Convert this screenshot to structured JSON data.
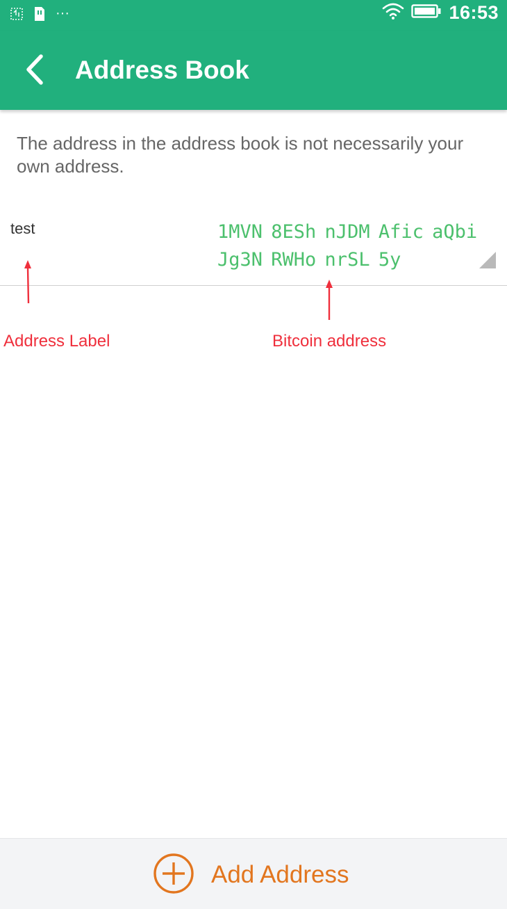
{
  "status_bar": {
    "time": "16:53",
    "overflow_text": "···",
    "icons": [
      "screenshot-icon",
      "sim-card-icon",
      "wifi-icon",
      "battery-icon"
    ]
  },
  "app_bar": {
    "title": "Address Book",
    "back_icon": "back-chevron-icon"
  },
  "notice": "The address in the address book is not necessarily your own address.",
  "entries": [
    {
      "label": "test",
      "address": "1MVN 8ESh nJDM Afic aQbi\nJg3N RWHo nrSL 5y"
    }
  ],
  "annotations": {
    "label_caption": "Address Label",
    "address_caption": "Bitcoin address"
  },
  "actions": {
    "add_address_label": "Add Address",
    "add_icon": "plus-circle-icon"
  },
  "colors": {
    "primary": "#21b07d",
    "address_text": "#4cc06d",
    "accent": "#e2761f",
    "annotation": "#ef2f3c"
  }
}
